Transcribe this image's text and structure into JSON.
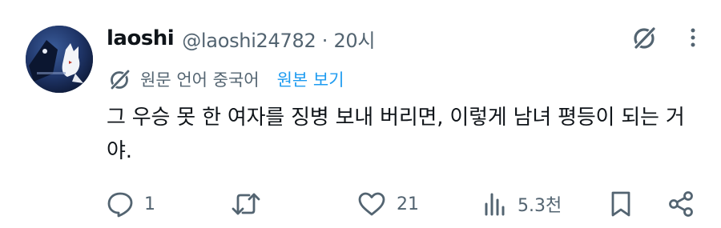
{
  "post": {
    "author": {
      "display_name": "laoshi",
      "handle": "@laoshi24782",
      "separator": "·",
      "time": "20시"
    },
    "translation": {
      "label": "원문 언어 중국어",
      "link": "원본 보기"
    },
    "text": "그 우승 못 한 여자를 징병 보내 버리면, 이렇게 남녀 평등이 되는 거야.",
    "actions": {
      "reply_count": "1",
      "repost_count": "",
      "like_count": "21",
      "view_count": "5.3천"
    }
  },
  "icons": {
    "grok": "grok-icon",
    "more": "more-icon",
    "translate": "translate-icon",
    "reply": "reply-icon",
    "repost": "repost-icon",
    "like": "like-icon",
    "views": "views-icon",
    "bookmark": "bookmark-icon",
    "share": "share-icon"
  },
  "colors": {
    "text": "#0f1419",
    "secondary": "#536471",
    "link": "#1d9bf0"
  }
}
